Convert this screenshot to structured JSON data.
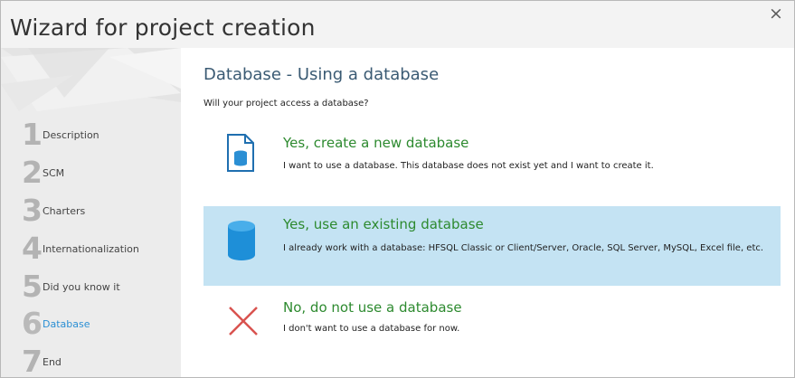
{
  "window": {
    "title": "Wizard for project creation",
    "close_glyph": "×"
  },
  "steps": [
    {
      "number": "1",
      "label": "Description",
      "active": false
    },
    {
      "number": "2",
      "label": "SCM",
      "active": false
    },
    {
      "number": "3",
      "label": "Charters",
      "active": false
    },
    {
      "number": "4",
      "label": "Internationalization",
      "active": false
    },
    {
      "number": "5",
      "label": "Did you know it",
      "active": false
    },
    {
      "number": "6",
      "label": "Database",
      "active": true
    },
    {
      "number": "7",
      "label": "End",
      "active": false
    }
  ],
  "main": {
    "heading": "Database - Using a database",
    "question": "Will your project access a database?",
    "options": [
      {
        "icon": "new-database-file-icon",
        "title": "Yes, create a new database",
        "description": "I want to use a database. This database does not exist yet and I want to create it.",
        "selected": false
      },
      {
        "icon": "database-cylinder-icon",
        "title": "Yes, use an existing database",
        "description": "I already work with a database: HFSQL Classic or Client/Server, Oracle, SQL Server, MySQL, Excel file, etc.",
        "selected": true
      },
      {
        "icon": "red-cross-icon",
        "title": "No, do not use a database",
        "description": "I don't want to use a database for now.",
        "selected": false
      }
    ]
  },
  "colors": {
    "accent_blue": "#2b8fd4",
    "selected_background": "#c4e3f3",
    "option_title_green": "#2d8a2f",
    "cross_red": "#d9534f"
  }
}
